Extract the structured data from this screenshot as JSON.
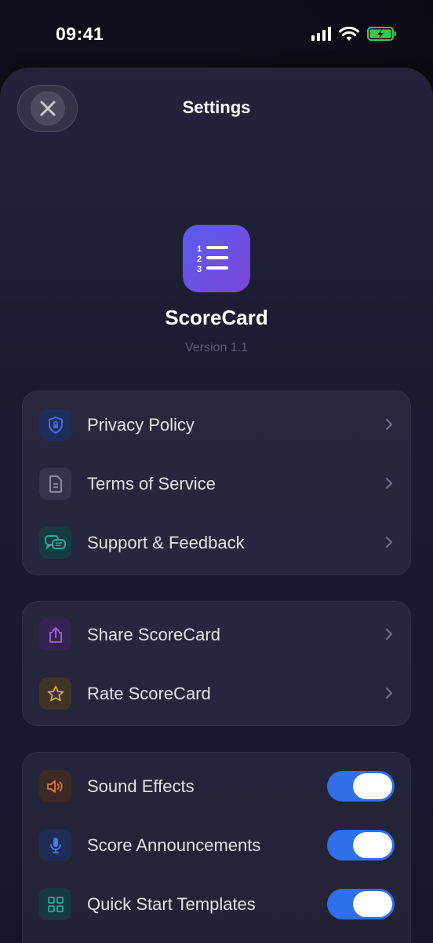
{
  "status_bar": {
    "time": "09:41"
  },
  "sheet": {
    "title": "Settings"
  },
  "app": {
    "name": "ScoreCard",
    "version": "Version 1.1",
    "icon": "numbered-list-icon"
  },
  "groups": [
    {
      "rows": [
        {
          "label": "Privacy Policy",
          "icon": "shield-lock-icon",
          "icon_color": "#3f6fe0",
          "icon_bg": "#1f2d5a"
        },
        {
          "label": "Terms of Service",
          "icon": "document-icon",
          "icon_color": "#8e8ea2",
          "icon_bg": "#34344a"
        },
        {
          "label": "Support & Feedback",
          "icon": "chat-bubbles-icon",
          "icon_color": "#2ba99a",
          "icon_bg": "#163b40"
        }
      ]
    },
    {
      "rows": [
        {
          "label": "Share ScoreCard",
          "icon": "share-icon",
          "icon_color": "#9a5ad8",
          "icon_bg": "#35244f"
        },
        {
          "label": "Rate ScoreCard",
          "icon": "star-icon",
          "icon_color": "#d8a53a",
          "icon_bg": "#3e3527"
        }
      ]
    },
    {
      "rows": [
        {
          "label": "Sound Effects",
          "icon": "speaker-icon",
          "icon_color": "#e2783a",
          "icon_bg": "#3d2a24",
          "toggle": true
        },
        {
          "label": "Score Announcements",
          "icon": "microphone-icon",
          "icon_color": "#4a78e6",
          "icon_bg": "#1f2c55",
          "toggle": true
        },
        {
          "label": "Quick Start Templates",
          "icon": "grid-icon",
          "icon_color": "#2ba99a",
          "icon_bg": "#173a40",
          "toggle": true
        }
      ]
    }
  ],
  "colors": {
    "accent": "#2f6fe8",
    "app_icon_start": "#5b5cf0",
    "app_icon_end": "#7a46d6"
  }
}
